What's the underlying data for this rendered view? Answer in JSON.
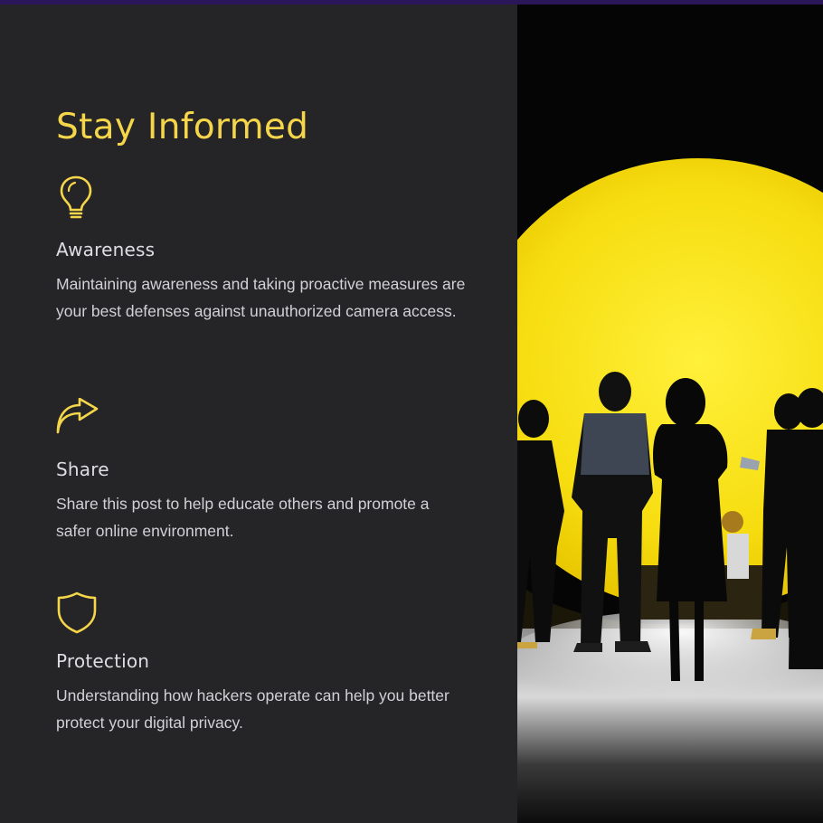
{
  "title": "Stay Informed",
  "features": [
    {
      "icon": "lightbulb-icon",
      "heading": "Awareness",
      "body": "Maintaining awareness and taking proactive measures are your best defenses against unauthorized camera access."
    },
    {
      "icon": "share-arrow-icon",
      "heading": "Share",
      "body": "Share this post to help educate others and promote a safer online environment."
    },
    {
      "icon": "shield-icon",
      "heading": "Protection",
      "body": "Understanding how hackers operate can help you better protect your digital privacy."
    }
  ],
  "colors": {
    "accent": "#f5d64a",
    "panel": "#252528",
    "top_bar": "#2a1658",
    "photo_glow": "#f8e21a"
  }
}
